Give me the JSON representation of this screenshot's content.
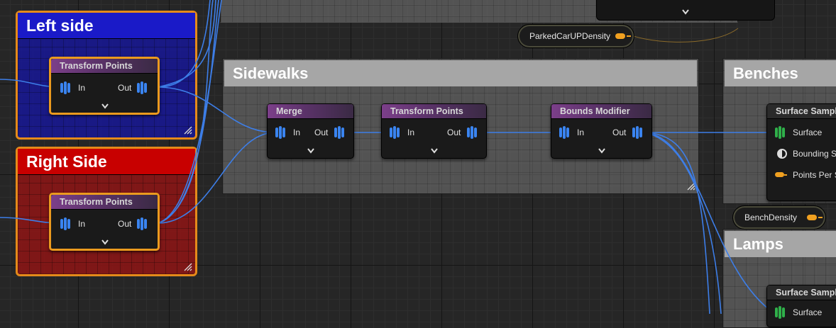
{
  "comments": {
    "left_side": "Left side",
    "right_side": "Right Side",
    "sidewalks": "Sidewalks",
    "benches": "Benches",
    "lamps": "Lamps"
  },
  "nodes": {
    "left_transform": {
      "title": "Transform Points",
      "in": "In",
      "out": "Out"
    },
    "right_transform": {
      "title": "Transform Points",
      "in": "In",
      "out": "Out"
    },
    "merge": {
      "title": "Merge",
      "in": "In",
      "out": "Out"
    },
    "sidewalk_transform": {
      "title": "Transform Points",
      "in": "In",
      "out": "Out"
    },
    "bounds_modifier": {
      "title": "Bounds Modifier",
      "in": "In",
      "out": "Out"
    },
    "bench_surface_sampler": {
      "title": "Surface Sampl",
      "pins": [
        "Surface",
        "Bounding S",
        "Points Per S"
      ]
    },
    "lamps_surface_sampler": {
      "title": "Surface Sampl",
      "pins": [
        "Surface"
      ]
    }
  },
  "variables": {
    "parked_car": "ParkedCarUPDensity",
    "bench_density": "BenchDensity"
  },
  "colors": {
    "wire": "#3d7ee8",
    "pin_blue": "#3a84f0",
    "pin_green": "#2fb04a",
    "float_pin": "#f0a020",
    "selection": "#eb9a1e",
    "left_comment": "#1a1ac8",
    "right_comment": "#c80000"
  }
}
